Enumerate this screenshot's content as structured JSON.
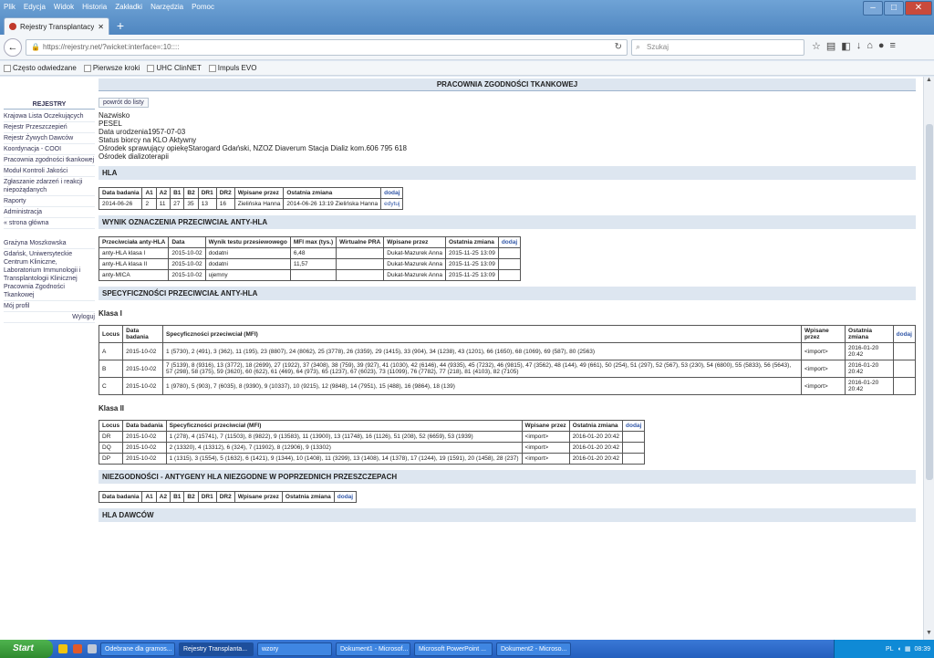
{
  "browser": {
    "menu": [
      "Plik",
      "Edycja",
      "Widok",
      "Historia",
      "Zakładki",
      "Narzędzia",
      "Pomoc"
    ],
    "tab_title": "Rejestry Transplantacyjne Ministe...",
    "url": "https://rejestry.net/?wicket:interface=:10::::",
    "search_placeholder": "Szukaj",
    "bookmarks": [
      "Często odwiedzane",
      "Pierwsze kroki",
      "UHC ClinNET",
      "Impuls EVO"
    ]
  },
  "page": {
    "title": "PRACOWNIA ZGODNOŚCI TKANKOWEJ",
    "back_button": "powrót do listy",
    "info": [
      "Nazwisko",
      "PESEL",
      "Data urodzenia1957-07-03",
      "Status biorcy na KLO      Aktywny",
      "Ośrodek sprawujący opiekęStarogard Gdański, NZOZ Diaverum Stacja Dializ kom.606 795 618",
      "Ośrodek dializoterapii"
    ]
  },
  "sidebar": {
    "header": "REJESTRY",
    "items": [
      "Krajowa Lista Oczekujących",
      "Rejestr Przeszczepień",
      "Rejestr Żywych Dawców",
      "Koordynacja - COOI",
      "Pracownia zgodności tkankowej",
      "Moduł Kontroli Jakości",
      "Zgłaszanie zdarzeń i reakcji niepożądanych",
      "Raporty",
      "Administracja",
      "« strona główna"
    ],
    "user_name": "Grażyna Moszkowska",
    "user_org": "Gdańsk, Uniwersyteckie Centrum Kliniczne, Laboratorium Immunologii i Transplantologii Klinicznej Pracownia Zgodności Tkankowej",
    "profile": "Mój profil",
    "logout": "Wyloguj"
  },
  "hla": {
    "header": "HLA",
    "columns": [
      "Data badania",
      "A1",
      "A2",
      "B1",
      "B2",
      "DR1",
      "DR2",
      "Wpisane przez",
      "Ostatnia zmiana",
      "dodaj"
    ],
    "rows": [
      [
        "2014-06-26",
        "2",
        "11",
        "27",
        "35",
        "13",
        "16",
        "Zielińska Hanna",
        "2014-06-26 13:19 Zielińska Hanna",
        "edytuj"
      ]
    ]
  },
  "antibody": {
    "header": "WYNIK OZNACZENIA PRZECIWCIAŁ ANTY-HLA",
    "columns": [
      "Przeciwciała anty-HLA",
      "Data",
      "Wynik testu przesiewowego",
      "MFI max (tys.)",
      "Wirtualne PRA",
      "Wpisane przez",
      "Ostatnia zmiana",
      "dodaj"
    ],
    "rows": [
      [
        "anty-HLA klasa I",
        "2015-10-02",
        "dodatni",
        "6,48",
        "",
        "Dukat-Mazurek Anna",
        "2015-11-25 13:09",
        ""
      ],
      [
        "anty-HLA klasa II",
        "2015-10-02",
        "dodatni",
        "11,57",
        "",
        "Dukat-Mazurek Anna",
        "2015-11-25 13:09",
        ""
      ],
      [
        "anty-MICA",
        "2015-10-02",
        "ujemny",
        "",
        "",
        "Dukat-Mazurek Anna",
        "2015-11-25 13:09",
        ""
      ]
    ]
  },
  "specificity": {
    "header": "SPECYFICZNOŚCI PRZECIWCIAŁ ANTY-HLA",
    "class1": {
      "title": "Klasa I",
      "columns": [
        "Locus",
        "Data badania",
        "Specyficzności przeciwciał (MFI)",
        "Wpisane przez",
        "Ostatnia zmiana",
        "dodaj"
      ],
      "rows": [
        [
          "A",
          "2015-10-02",
          "1 (5730), 2 (491), 3 (362), 11 (195), 23 (8807), 24 (8062), 25 (3778), 26 (3359), 29 (1415), 33 (904), 34 (1238), 43 (1201), 66 (1650), 68 (1069), 69 (587), 80 (2563)",
          "<import>",
          "2016-01-20 20:42",
          ""
        ],
        [
          "B",
          "2015-10-02",
          "7 (5139), 8 (9316), 13 (3772), 18 (2699), 27 (1922), 37 (3408), 38 (759), 39 (927), 41 (1030), 42 (6146), 44 (9335), 45 (7232), 46 (9815), 47 (3562), 48 (144), 49 (661), 50 (254), 51 (297), 52 (567), 53 (230), 54 (6800), 55 (5833), 56 (5643), 57 (298), 58 (375), 59 (3620), 60 (622), 61 (469), 64 (973), 65 (1237), 67 (6023), 73 (11099), 76 (7782), 77 (218), 81 (4103), 82 (7105)",
          "<import>",
          "2016-01-20 20:42",
          ""
        ],
        [
          "C",
          "2015-10-02",
          "1 (9780), 5 (903), 7 (6035), 8 (9390), 9 (10337), 10 (9215), 12 (9848), 14 (7951), 15 (488), 16 (9864), 18 (139)",
          "<import>",
          "2016-01-20 20:42",
          ""
        ]
      ]
    },
    "class2": {
      "title": "Klasa II",
      "columns": [
        "Locus",
        "Data badania",
        "Specyficzności przeciwciał (MFI)",
        "Wpisane przez",
        "Ostatnia zmiana",
        "dodaj"
      ],
      "rows": [
        [
          "DR",
          "2015-10-02",
          "1 (278), 4 (15741), 7 (11503), 8 (9822), 9 (13583), 11 (13900), 13 (11748), 16 (1126), 51 (208), 52 (6659), 53 (1939)",
          "<import>",
          "2016-01-20 20:42",
          ""
        ],
        [
          "DQ",
          "2015-10-02",
          "2 (13320), 4 (13312), 6 (324), 7 (11902), 8 (12906), 9 (13302)",
          "<import>",
          "2016-01-20 20:42",
          ""
        ],
        [
          "DP",
          "2015-10-02",
          "1 (1315), 3 (1554), 5 (1632), 6 (1421), 9 (1344), 10 (1408), 11 (3299), 13 (1408), 14 (1378), 17 (1244), 19 (1591), 20 (1458), 28 (237)",
          "<import>",
          "2016-01-20 20:42",
          ""
        ]
      ]
    }
  },
  "nonmatch": {
    "header": "NIEZGODNOŚCI - ANTYGENY HLA NIEZGODNE W POPRZEDNICH PRZESZCZEPACH",
    "columns": [
      "Data badania",
      "A1",
      "A2",
      "B1",
      "B2",
      "DR1",
      "DR2",
      "Wpisane przez",
      "Ostatnia zmiana",
      "dodaj"
    ]
  },
  "donors": {
    "header": "HLA DAWCÓW"
  },
  "taskbar": {
    "start": "Start",
    "tasks": [
      "Odebrane dla gramos...",
      "Rejestry Transplanta...",
      "wzory",
      "Dokument1 - Microsof...",
      "Microsoft PowerPoint ...",
      "Dokument2 - Microso..."
    ],
    "lang": "PL",
    "clock": "08:39"
  }
}
